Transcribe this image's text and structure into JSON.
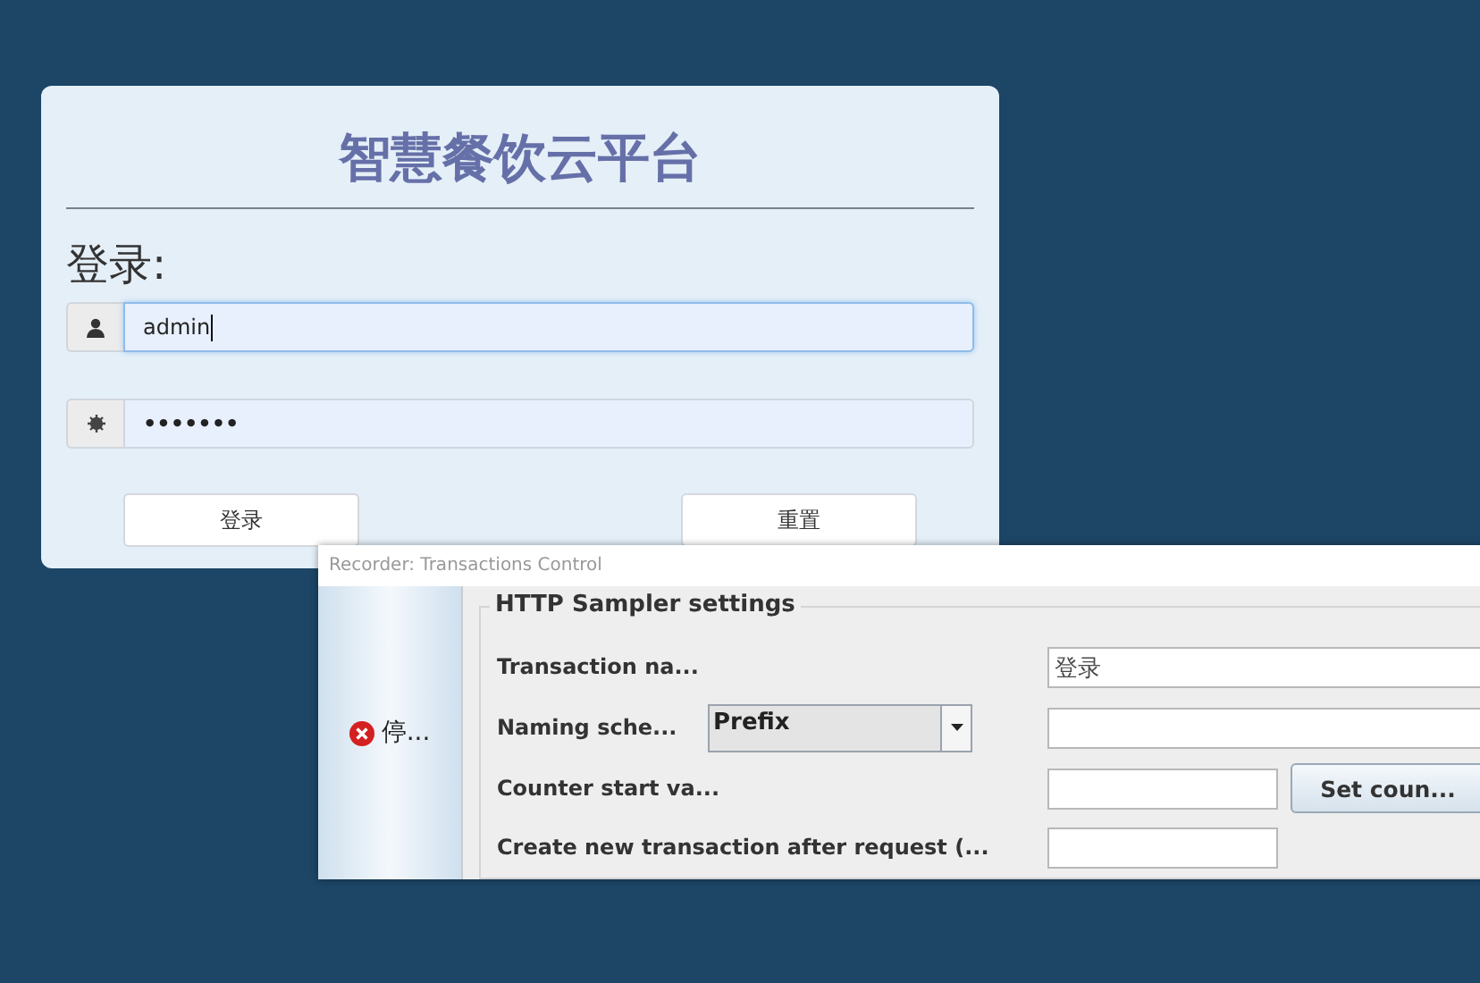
{
  "login_card": {
    "title": "智慧餐饮云平台",
    "heading": "登录:",
    "fields": [
      {
        "kind": "user",
        "value": "admin",
        "focused": true
      },
      {
        "kind": "password",
        "value": "•••••••",
        "focused": false
      }
    ],
    "buttons": [
      "登录",
      "重置"
    ]
  },
  "dialog": {
    "title": "Recorder: Transactions Control",
    "stop_button": "停...",
    "group_title": "HTTP Sampler settings",
    "rows": [
      {
        "kind": "text",
        "label": "Transaction na...",
        "value": "登录"
      },
      {
        "kind": "combo",
        "label": "Naming sche...",
        "combo_value": "Prefix",
        "value": ""
      },
      {
        "kind": "button",
        "label": "Counter start va...",
        "value": "",
        "button": "Set coun..."
      },
      {
        "kind": "short",
        "label": "Create new transaction after request (...",
        "value": ""
      }
    ]
  }
}
